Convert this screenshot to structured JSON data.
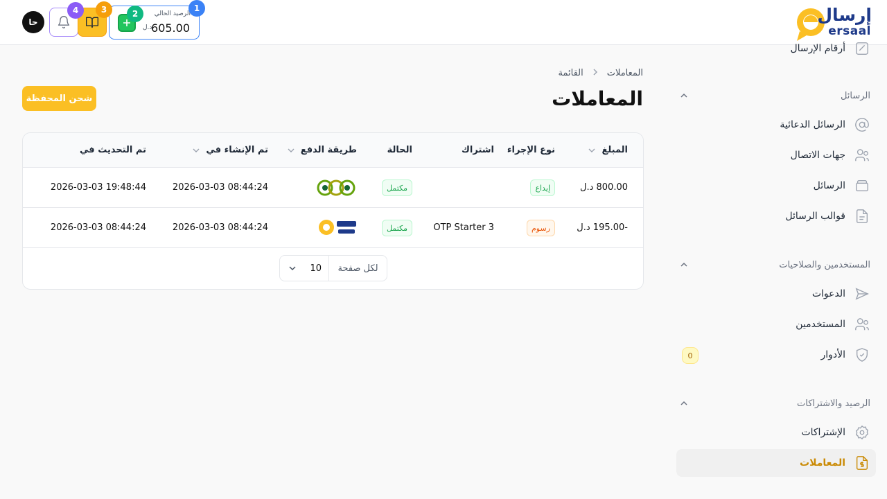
{
  "header": {
    "logo_ar": "إرسال",
    "logo_en": "ersaal",
    "avatar_initials": "حا",
    "balance_label": "الرصيد الحالي",
    "balance_value": "605.00",
    "balance_unit": "د.ل",
    "badges": {
      "b1": "1",
      "b2": "2",
      "b3": "3",
      "b4": "4"
    }
  },
  "sidebar": {
    "top_item": "أرقام الإرسال",
    "sections": [
      {
        "label": "الرسائل",
        "items": [
          "الرسائل الدعائية",
          "جهات الاتصال",
          "الرسائل",
          "قوالب الرسائل"
        ]
      },
      {
        "label": "المستخدمين والصلاحيات",
        "items": [
          "الدعوات",
          "المستخدمين",
          "الأدوار"
        ]
      },
      {
        "label": "الرصيد والاشتراكات",
        "items": [
          "الإشتراكات",
          "المعاملات"
        ]
      }
    ],
    "roles_count": "0"
  },
  "main": {
    "breadcrumb": [
      "المعاملات",
      "القائمة"
    ],
    "title": "المعاملات",
    "wallet_button": "شحن المحفظة"
  },
  "table": {
    "columns": [
      "المبلغ",
      "نوع الإجراء",
      "اشتراك",
      "الحالة",
      "طريقة الدفع",
      "تم الإنشاء في",
      "تم التحديث في"
    ],
    "rows": [
      {
        "amount": "800.00 د.ل",
        "type": "إيداع",
        "subscription": "",
        "status": "مكتمل",
        "payment": "card-provider-logo",
        "created": "2026-03-03 08:44:24",
        "updated": "2026-03-03 19:48:44"
      },
      {
        "amount": "-195.00 د.ل",
        "type": "رسوم",
        "subscription": "OTP Starter 3",
        "status": "مكتمل",
        "payment": "ersaal-logo",
        "created": "2026-03-03 08:44:24",
        "updated": "2026-03-03 08:44:24"
      }
    ]
  },
  "pagination": {
    "per_page_label": "لكل صفحة",
    "per_page_value": "10"
  },
  "colors": {
    "accent": "#fbbf24",
    "brand": "#1e3a8a",
    "success": "#16a34a",
    "warning": "#ea580c"
  }
}
